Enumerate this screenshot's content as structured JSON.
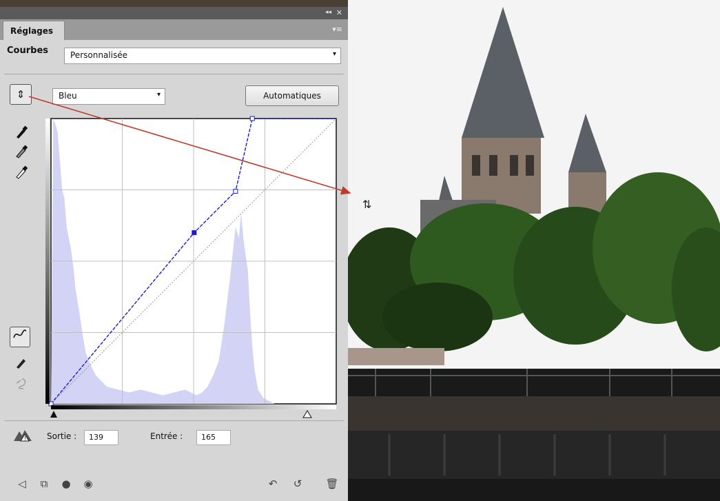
{
  "panel": {
    "tab_label": "Réglages",
    "adjustment_label": "Courbes",
    "preset_value": "Personnalisée",
    "channel_value": "Bleu",
    "auto_button_label": "Automatiques",
    "output_label": "Sortie :",
    "output_value": "139",
    "input_label": "Entrée :",
    "input_value": "165",
    "collapse_glyph": "◂◂",
    "close_glyph": "✕",
    "menu_glyph": "▾≡",
    "dropdown_glyph": "▾"
  },
  "icons": {
    "onimage_tool": "on-image-adjustment-icon",
    "eyedroppers": [
      "black-point-eyedropper-icon",
      "gray-point-eyedropper-icon",
      "white-point-eyedropper-icon"
    ],
    "curve_tools": [
      "curve-edit-icon",
      "pencil-icon",
      "smooth-curve-icon"
    ],
    "bottom_left": [
      "back-arrow-icon",
      "clip-to-layer-icon",
      "visibility-icon",
      "eye-icon"
    ],
    "bottom_right": [
      "previous-state-icon",
      "reset-icon",
      "trash-icon"
    ]
  },
  "chart_data": {
    "type": "area",
    "xlim": [
      0,
      255
    ],
    "ylim": [
      0,
      255
    ],
    "curve_points": [
      [
        0,
        0
      ],
      [
        128,
        153
      ],
      [
        165,
        190
      ],
      [
        180,
        255
      ],
      [
        255,
        255
      ]
    ],
    "histogram_color": "#d3d3f5",
    "curve_color": "#1a1ad0",
    "histogram": [
      [
        0,
        0
      ],
      [
        2,
        100
      ],
      [
        4,
        98
      ],
      [
        6,
        95
      ],
      [
        8,
        85
      ],
      [
        10,
        75
      ],
      [
        12,
        72
      ],
      [
        14,
        62
      ],
      [
        16,
        58
      ],
      [
        18,
        54
      ],
      [
        20,
        48
      ],
      [
        22,
        40
      ],
      [
        25,
        33
      ],
      [
        28,
        25
      ],
      [
        31,
        18
      ],
      [
        35,
        14
      ],
      [
        40,
        10
      ],
      [
        45,
        8
      ],
      [
        50,
        6
      ],
      [
        60,
        5
      ],
      [
        70,
        4
      ],
      [
        80,
        5
      ],
      [
        90,
        4
      ],
      [
        100,
        3
      ],
      [
        110,
        4
      ],
      [
        120,
        5
      ],
      [
        130,
        3
      ],
      [
        135,
        4
      ],
      [
        140,
        6
      ],
      [
        145,
        10
      ],
      [
        150,
        15
      ],
      [
        155,
        28
      ],
      [
        160,
        44
      ],
      [
        165,
        62
      ],
      [
        168,
        58
      ],
      [
        170,
        67
      ],
      [
        172,
        58
      ],
      [
        174,
        52
      ],
      [
        176,
        47
      ],
      [
        178,
        32
      ],
      [
        180,
        20
      ],
      [
        182,
        12
      ],
      [
        185,
        5
      ],
      [
        190,
        2
      ],
      [
        200,
        0
      ],
      [
        255,
        0
      ]
    ],
    "colors": {
      "panel": "#d6d6d6",
      "accent_curve": "#1a1ad0",
      "callout_arrow": "#c0392b"
    }
  }
}
